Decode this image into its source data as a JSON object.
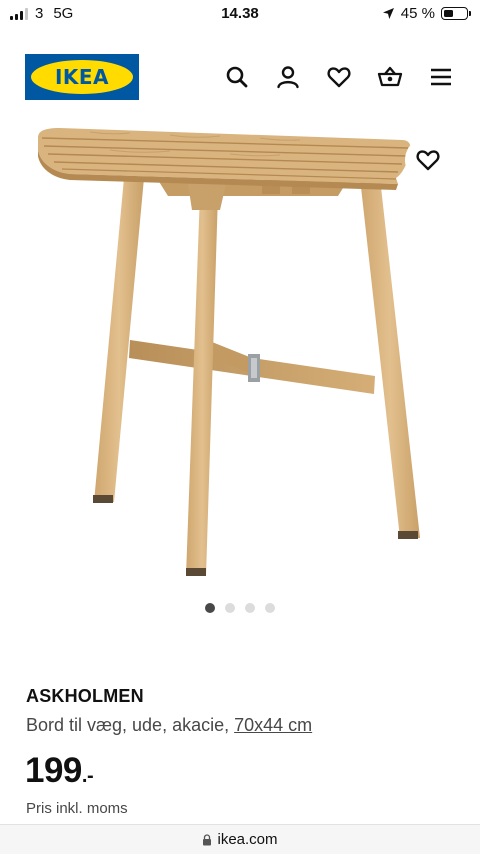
{
  "status_bar": {
    "carrier": "3",
    "network": "5G",
    "time": "14.38",
    "battery_text": "45 %"
  },
  "header": {
    "logo_text": "IKEA",
    "icons": [
      "search-icon",
      "user-icon",
      "heart-icon",
      "basket-icon",
      "menu-icon"
    ]
  },
  "gallery": {
    "image_count": 4,
    "active_index": 0
  },
  "product": {
    "name": "ASKHOLMEN",
    "description": "Bord til væg, ude, akacie, ",
    "size": "70x44 cm",
    "price": "199",
    "price_suffix": ".-",
    "price_note": "Pris inkl. moms"
  },
  "browser": {
    "url": "ikea.com"
  },
  "colors": {
    "ikea_blue": "#0058a3",
    "ikea_yellow": "#ffdb00",
    "wood": "#d9b47f"
  }
}
